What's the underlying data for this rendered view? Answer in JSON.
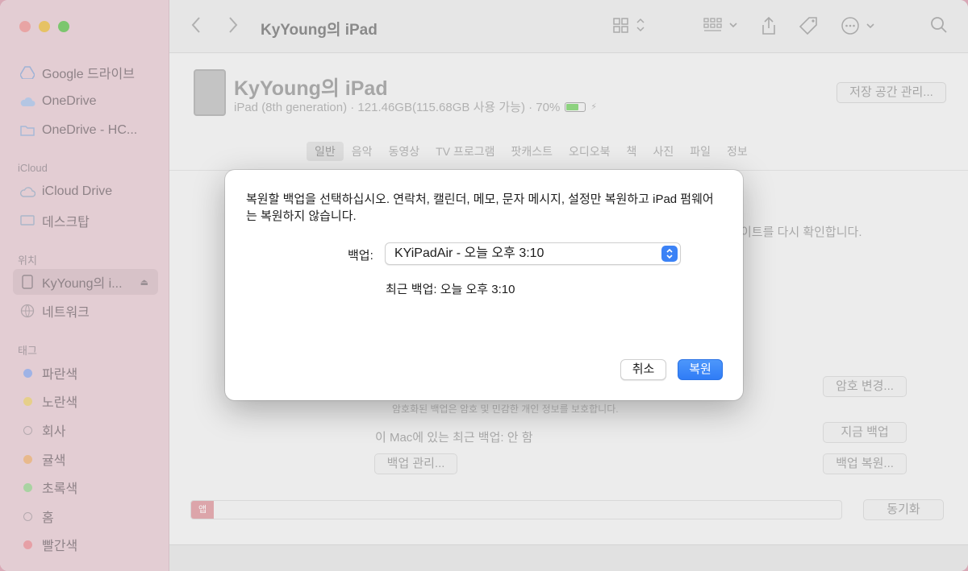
{
  "window": {
    "title": "KyYoung의 iPad"
  },
  "sidebar": {
    "cloud_items": [
      {
        "label": "Google 드라이브",
        "icon": "google-drive-icon"
      },
      {
        "label": "OneDrive",
        "icon": "cloud-icon"
      },
      {
        "label": "OneDrive - HC...",
        "icon": "folder-icon"
      }
    ],
    "icloud_header": "iCloud",
    "icloud_items": [
      {
        "label": "iCloud Drive",
        "icon": "icloud-icon"
      },
      {
        "label": "데스크탑",
        "icon": "desktop-icon"
      }
    ],
    "location_header": "위치",
    "location_items": [
      {
        "label": "KyYoung의 i...",
        "icon": "ipad-icon"
      },
      {
        "label": "네트워크",
        "icon": "network-icon"
      }
    ],
    "tags_header": "태그",
    "tags": [
      {
        "label": "파란색",
        "color": "#9fb3e6"
      },
      {
        "label": "노란색",
        "color": "#e6cf8a"
      },
      {
        "label": "회사",
        "color": ""
      },
      {
        "label": "귤색",
        "color": "#e8b98c"
      },
      {
        "label": "초록색",
        "color": "#a9d3a2"
      },
      {
        "label": "홈",
        "color": ""
      },
      {
        "label": "빨간색",
        "color": "#e6a0a6"
      }
    ]
  },
  "device": {
    "name": "KyYoung의 iPad",
    "info": "iPad (8th generation) · 121.46GB(115.68GB 사용 가능) · 70%",
    "battery_level": 0.7,
    "manage_storage": "저장 공간 관리..."
  },
  "tabs": [
    "일반",
    "음악",
    "동영상",
    "TV 프로그램",
    "팟캐스트",
    "오디오북",
    "책",
    "사진",
    "파일",
    "정보"
  ],
  "background": {
    "update_check_text": "이트를 다시 확인합니다.",
    "change_password": "암호 변경...",
    "encrypt_note": "암호화된 백업은 암호 및 민감한 개인 정보를 보호합니다.",
    "last_backup": "이 Mac에 있는 최근 백업: 안 함",
    "backup_now": "지금 백업",
    "manage_backups": "백업 관리...",
    "restore_backup": "백업 복원...",
    "storage_app": "앱",
    "sync": "동기화"
  },
  "dialog": {
    "message": "복원할 백업을 선택하십시오. 연락처, 캘린더, 메모, 문자 메시지, 설정만 복원하고 iPad 펌웨어는 복원하지 않습니다.",
    "backup_label": "백업:",
    "backup_selected": "KYiPadAir - 오늘 오후 3:10",
    "recent_backup": "최근 백업:  오늘 오후 3:10",
    "cancel": "취소",
    "restore": "복원"
  }
}
